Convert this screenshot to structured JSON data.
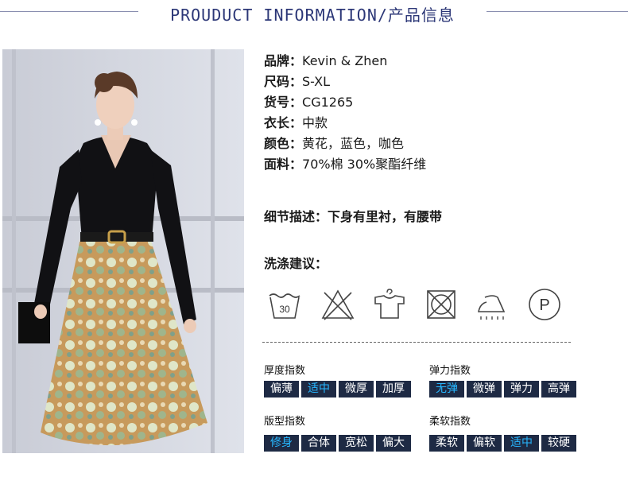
{
  "header": {
    "title": "PROUDUCT INFORMATION/产品信息"
  },
  "specs": [
    {
      "key": "品牌：",
      "value": "Kevin & Zhen"
    },
    {
      "key": "尺码：",
      "value": "S-XL"
    },
    {
      "key": "货号：",
      "value": "CG1265"
    },
    {
      "key": "衣长：",
      "value": "中款"
    },
    {
      "key": "颜色：",
      "value": "黄花，蓝色，咖色"
    },
    {
      "key": "面料：",
      "value": "70%棉 30%聚酯纤维"
    }
  ],
  "detail": {
    "text": "细节描述：下身有里衬，有腰带"
  },
  "wash": {
    "title": "洗涤建议：",
    "temp_label": "30",
    "icons": [
      "wash-30-icon",
      "no-bleach-icon",
      "hang-dry-icon",
      "no-tumble-dry-icon",
      "iron-icon",
      "dry-clean-p-icon"
    ],
    "dryclean_label": "P"
  },
  "indices": {
    "thickness": {
      "title": "厚度指数",
      "options": [
        "偏薄",
        "适中",
        "微厚",
        "加厚"
      ],
      "selected": "适中"
    },
    "elasticity": {
      "title": "弹力指数",
      "options": [
        "无弹",
        "微弹",
        "弹力",
        "高弹"
      ],
      "selected": "无弹"
    },
    "fit": {
      "title": "版型指数",
      "options": [
        "修身",
        "合体",
        "宽松",
        "偏大"
      ],
      "selected": "修身"
    },
    "softness": {
      "title": "柔软指数",
      "options": [
        "柔软",
        "偏软",
        "适中",
        "较硬"
      ],
      "selected": "适中"
    }
  },
  "colors": {
    "title": "#2c3777",
    "segment_bg": "#1e2a44",
    "segment_active_text": "#27b7ff",
    "segment_text": "#ffffff"
  }
}
